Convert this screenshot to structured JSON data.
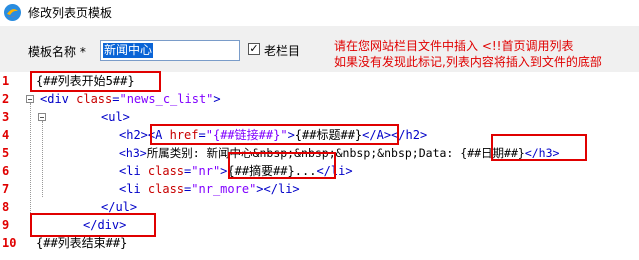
{
  "window": {
    "title": "修改列表页模板"
  },
  "form": {
    "name_label": "模板名称",
    "required_mark": "*",
    "name_value": "新闻中心",
    "checkbox_label": "老栏目",
    "checkbox_mark": "✓",
    "note_line1": "请在您网站栏目文件中插入      <!!首页调用列表",
    "note_line2": "如果没有发现此标记,列表内容将插入到文件的底部"
  },
  "editor": {
    "line_numbers": [
      "1",
      "2",
      "3",
      "4",
      "5",
      "6",
      "7",
      "8",
      "9",
      "10"
    ],
    "line1": "{##列表开始5##}",
    "line2": {
      "open": "<div ",
      "attr": "class",
      "eq": "=",
      "val": "\"news_c_list\"",
      "close": ">"
    },
    "line3": "<ul>",
    "line4": {
      "h2": "<h2>",
      "a_open": "<A ",
      "href": "href",
      "eq": "=",
      "q1": "\"",
      "link": "{##链接##}",
      "q2": "\"",
      "gt": ">",
      "title_tag": "{##标题##}",
      "a_close": "</A>",
      "h2_close": "</h2>"
    },
    "line5": {
      "h3": "<h3>",
      "text": "所属类别: 新闻中心&nbsp;&nbsp;&nbsp;&nbsp;Data: ",
      "date_tag": "{##日期##}",
      "h3_close": "</h3>"
    },
    "line6": {
      "li": "<li ",
      "attr": "class",
      "eq": "=",
      "val": "\"nr\"",
      "gt": ">",
      "summary_tag": "{##摘要##}",
      "ellipsis": "...",
      "li_close": "</li>"
    },
    "line7": {
      "li": "<li ",
      "attr": "class",
      "eq": "=",
      "val": "\"nr_more\"",
      "gt": "></li>"
    },
    "line8": "</ul>",
    "line9": "</div>",
    "line10": "{##列表结束##}"
  }
}
